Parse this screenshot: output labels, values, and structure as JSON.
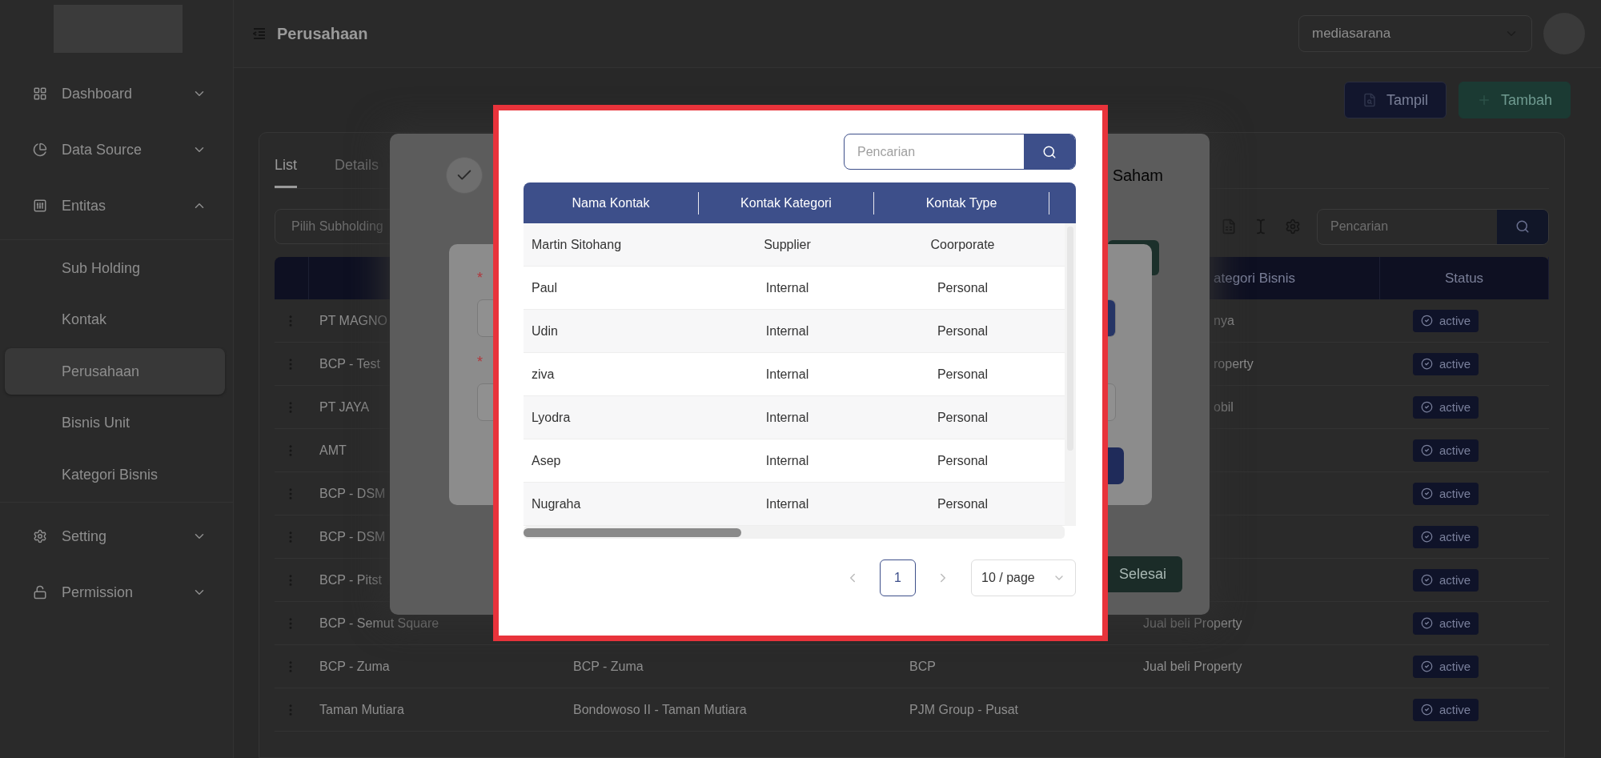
{
  "sidebar": {
    "items": [
      {
        "label": "Dashboard",
        "expanded": false
      },
      {
        "label": "Data Source",
        "expanded": false
      },
      {
        "label": "Entitas",
        "expanded": true,
        "children": [
          {
            "label": "Sub Holding",
            "selected": false
          },
          {
            "label": "Kontak",
            "selected": false
          },
          {
            "label": "Perusahaan",
            "selected": true
          },
          {
            "label": "Bisnis Unit",
            "selected": false
          },
          {
            "label": "Kategori Bisnis",
            "selected": false
          }
        ]
      },
      {
        "label": "Setting",
        "expanded": false
      },
      {
        "label": "Permission",
        "expanded": false
      }
    ]
  },
  "header": {
    "title": "Perusahaan",
    "company_select": "mediasarana"
  },
  "actions": [
    {
      "label": "Tampil",
      "kind": "view"
    },
    {
      "label": "Tambah",
      "kind": "add"
    }
  ],
  "tabs": [
    {
      "label": "List",
      "selected": true
    },
    {
      "label": "Details",
      "selected": false
    }
  ],
  "filter": {
    "placeholder": "Pilih Subholding"
  },
  "search": {
    "placeholder": "Pencarian"
  },
  "table": {
    "header": {
      "column_4": "ategori Bisnis",
      "status": "Status"
    },
    "rows": [
      {
        "name": "PT MAGNO",
        "column_4": "nya",
        "status": "active"
      },
      {
        "name": "BCP - Test",
        "column_4": "roperty",
        "status": "active"
      },
      {
        "name": "PT JAYA",
        "column_4": "obil",
        "status": "active"
      },
      {
        "name": "AMT",
        "status": "active"
      },
      {
        "name": "BCP - DSM",
        "status": "active"
      },
      {
        "name": "BCP - DSM",
        "status": "active"
      },
      {
        "name": "BCP - Pitst",
        "status": "active"
      },
      {
        "name": "BCP - Semut Square",
        "column_4": "Jual beli Property",
        "status": "active"
      },
      {
        "name": "BCP - Zuma",
        "column_2": "BCP - Zuma",
        "column_3": "BCP",
        "column_4": "Jual beli Property",
        "status": "active"
      },
      {
        "name": "Taman Mutiara",
        "column_2": "Bondowoso II - Taman Mutiara",
        "column_3": "PJM Group - Pusat",
        "status": "active"
      }
    ]
  },
  "form_dialog": {
    "step_done": true,
    "step_label": "Saham",
    "done_button": "Selesai",
    "fields": [
      {
        "mark": "*"
      },
      {
        "mark": "*"
      }
    ]
  },
  "contact_picker": {
    "search": {
      "placeholder": "Pencarian"
    },
    "columns": [
      "Nama Kontak",
      "Kontak Kategori",
      "Kontak Type"
    ],
    "rows": [
      {
        "name": "Martin Sitohang",
        "category": "Supplier",
        "type": "Coorporate"
      },
      {
        "name": "Paul",
        "category": "Internal",
        "type": "Personal"
      },
      {
        "name": "Udin",
        "category": "Internal",
        "type": "Personal"
      },
      {
        "name": "ziva",
        "category": "Internal",
        "type": "Personal"
      },
      {
        "name": "Lyodra",
        "category": "Internal",
        "type": "Personal"
      },
      {
        "name": "Asep",
        "category": "Internal",
        "type": "Personal"
      },
      {
        "name": "Nugraha",
        "category": "Internal",
        "type": "Personal"
      }
    ],
    "pagination": {
      "pages": [
        {
          "label": "1",
          "selected": true
        }
      ],
      "page_size": "10 / page"
    }
  }
}
